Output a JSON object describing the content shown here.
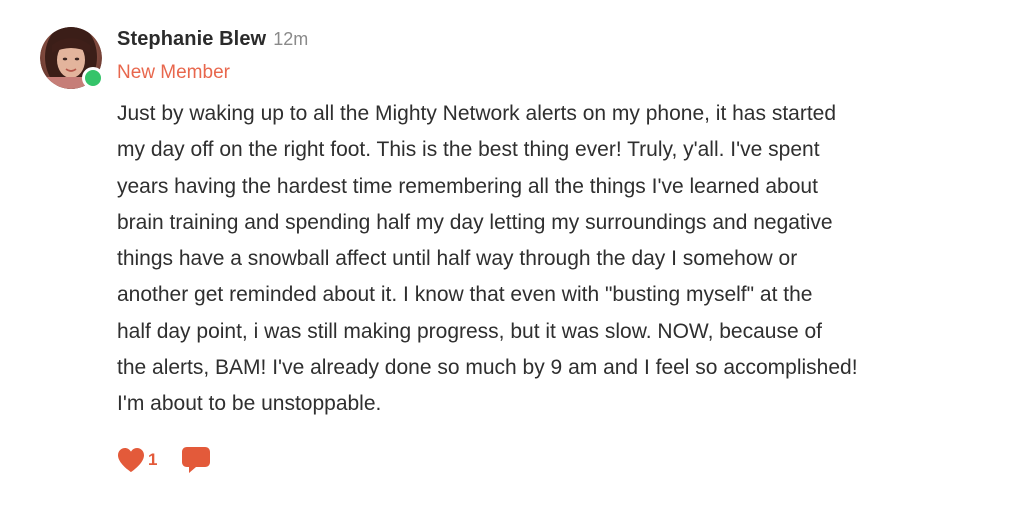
{
  "post": {
    "author": {
      "name": "Stephanie Blew",
      "role": "New Member",
      "online": true
    },
    "timestamp": "12m",
    "body_lines": [
      "Just by waking up to all the Mighty Network alerts on my phone, it has started",
      "my day off on the right foot. This is the best thing ever! Truly, y'all. I've spent",
      "years having the hardest time remembering all the things I've learned about",
      "brain training and spending half my day letting my surroundings and negative",
      "things have a snowball affect until half way through the day I somehow or",
      "another get reminded about it. I know that even with \"busting myself\" at the",
      "half day point, i was still making progress, but it was slow. NOW, because of",
      "the alerts, BAM! I've already done so much by 9 am and I feel so accomplished!",
      "I'm about to be unstoppable."
    ],
    "actions": {
      "like_count": "1",
      "like_icon": "heart-icon",
      "comment_icon": "speech-bubble-icon"
    }
  },
  "colors": {
    "accent": "#e35a3a",
    "role": "#e8674d",
    "online": "#35c46a",
    "text": "#2f2f2f",
    "muted": "#8a8a8a"
  }
}
